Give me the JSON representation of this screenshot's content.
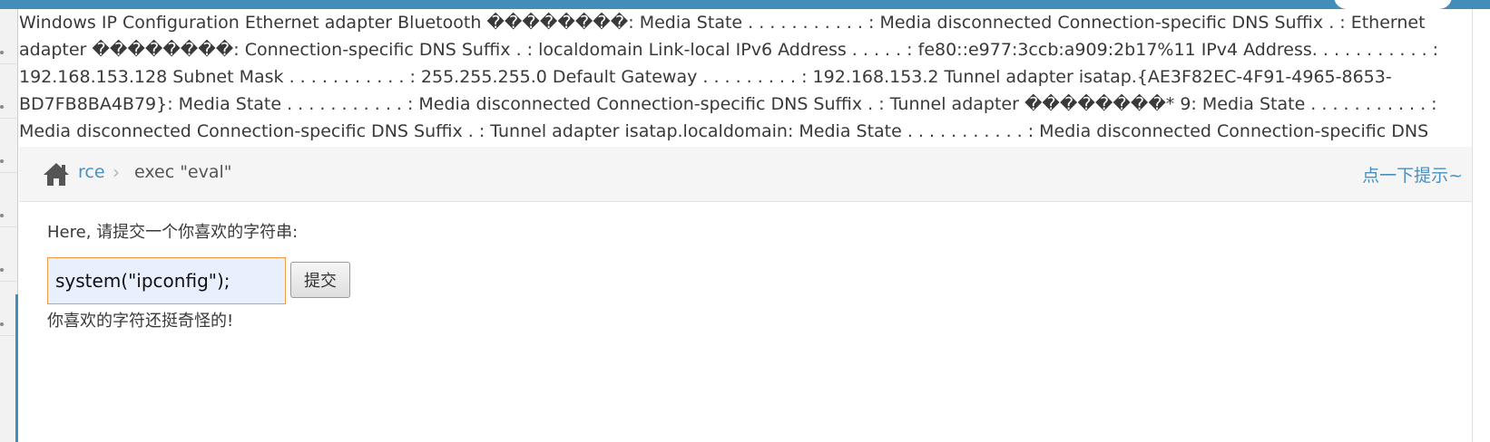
{
  "output": {
    "text": "Windows IP Configuration Ethernet adapter Bluetooth ��������: Media State . . . . . . . . . . . : Media disconnected Connection-specific DNS Suffix . : Ethernet adapter ��������: Connection-specific DNS Suffix . : localdomain Link-local IPv6 Address . . . . . : fe80::e977:3ccb:a909:2b17%11 IPv4 Address. . . . . . . . . . . : 192.168.153.128 Subnet Mask . . . . . . . . . . . : 255.255.255.0 Default Gateway . . . . . . . . . : 192.168.153.2 Tunnel adapter isatap.{AE3F82EC-4F91-4965-8653-BD7FB8BA4B79}: Media State . . . . . . . . . . . : Media disconnected Connection-specific DNS Suffix . : Tunnel adapter ��������* 9: Media State . . . . . . . . . . . : Media disconnected Connection-specific DNS Suffix . : Tunnel adapter isatap.localdomain: Media State . . . . . . . . . . . : Media disconnected Connection-specific DNS Suffix . : localdomain"
  },
  "breadcrumb": {
    "home_icon": "home-icon",
    "link": "rce",
    "separator": "›",
    "active": "exec \"eval\""
  },
  "hint": "点一下提示~",
  "form": {
    "prompt": "Here, 请提交一个你喜欢的字符串:",
    "input_value": "system(\"ipconfig\");",
    "submit_label": "提交"
  },
  "result_message": "你喜欢的字符还挺奇怪的!",
  "colors": {
    "topbar": "#438eb9",
    "link": "#4c8fbd",
    "input_border": "#f59942",
    "input_bg": "#e8f0fe"
  }
}
